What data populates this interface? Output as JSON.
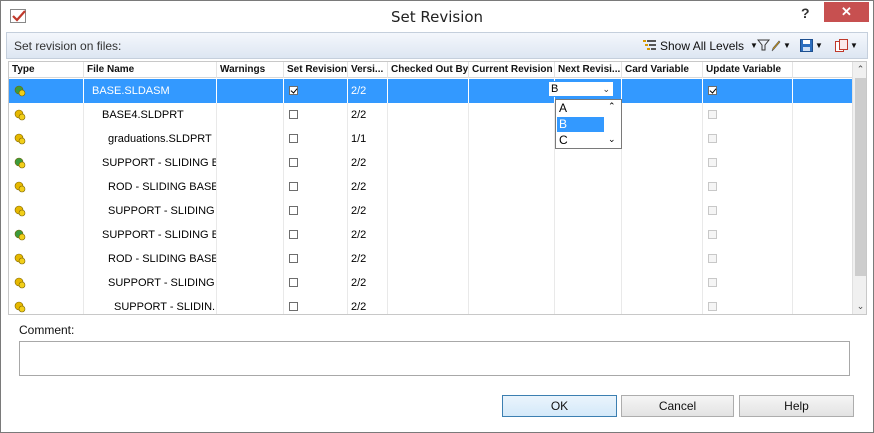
{
  "window": {
    "title": "Set Revision",
    "help_glyph": "?",
    "close_glyph": "✕"
  },
  "toolbar": {
    "label": "Set revision on files:",
    "show_levels": "Show All Levels",
    "filter_icon": "filter-icon",
    "save_icon": "save-icon",
    "copy_icon": "copy-icon"
  },
  "columns": [
    "Type",
    "File Name",
    "Warnings",
    "Set Revision",
    "Versi...",
    "Checked Out By",
    "Current Revision",
    "Next Revisi...",
    "Card Variable",
    "Update Variable"
  ],
  "rows": [
    {
      "type": "assembly",
      "name": "BASE.SLDASM",
      "set_revision": true,
      "version": "2/2",
      "next_revision": "B",
      "update_variable": true,
      "selected": true
    },
    {
      "type": "part",
      "name": "BASE4.SLDPRT",
      "set_revision": false,
      "version": "2/2",
      "next_revision": "",
      "update_variable": false,
      "selected": false
    },
    {
      "type": "part",
      "name": "graduations.SLDPRT",
      "set_revision": false,
      "version": "1/1",
      "next_revision": "",
      "update_variable": false,
      "selected": false
    },
    {
      "type": "assembly",
      "name": "SUPPORT - SLIDING B...",
      "set_revision": false,
      "version": "2/2",
      "next_revision": "",
      "update_variable": false,
      "selected": false
    },
    {
      "type": "part",
      "name": "ROD - SLIDING BASE ...",
      "set_revision": false,
      "version": "2/2",
      "next_revision": "",
      "update_variable": false,
      "selected": false
    },
    {
      "type": "part",
      "name": "SUPPORT - SLIDING ...",
      "set_revision": false,
      "version": "2/2",
      "next_revision": "",
      "update_variable": false,
      "selected": false
    },
    {
      "type": "assembly",
      "name": "SUPPORT - SLIDING B...",
      "set_revision": false,
      "version": "2/2",
      "next_revision": "",
      "update_variable": false,
      "selected": false
    },
    {
      "type": "part",
      "name": "ROD - SLIDING BASE ...",
      "set_revision": false,
      "version": "2/2",
      "next_revision": "",
      "update_variable": false,
      "selected": false
    },
    {
      "type": "part",
      "name": "SUPPORT - SLIDING ...",
      "set_revision": false,
      "version": "2/2",
      "next_revision": "",
      "update_variable": false,
      "selected": false
    },
    {
      "type": "part",
      "name": "SUPPORT - SLIDIN...",
      "set_revision": false,
      "version": "2/2",
      "next_revision": "",
      "update_variable": false,
      "selected": false
    }
  ],
  "revision_dropdown": {
    "value": "B",
    "options": [
      "A",
      "B",
      "C"
    ],
    "highlighted": "B"
  },
  "comment": {
    "label": "Comment:",
    "value": ""
  },
  "buttons": {
    "ok": "OK",
    "cancel": "Cancel",
    "help": "Help"
  },
  "colors": {
    "selection": "#3399ff",
    "close": "#c75050",
    "assembly_icon": "#3c9b3c",
    "part_icon": "#e6b800"
  }
}
